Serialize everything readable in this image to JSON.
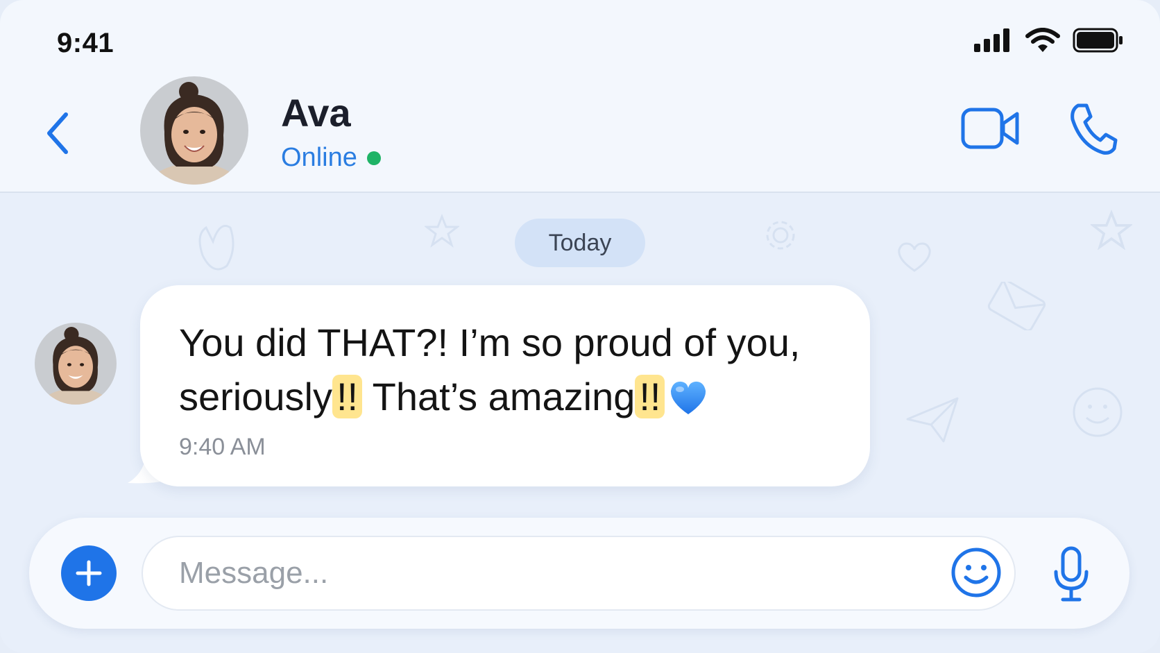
{
  "status_bar": {
    "time": "9:41",
    "icons": [
      "cellular-signal-icon",
      "wifi-icon",
      "battery-icon"
    ]
  },
  "header": {
    "back_icon": "chevron-left-icon",
    "contact_name": "Ava",
    "presence": "Online",
    "presence_color": "#1fb366",
    "actions": [
      "video-call-icon",
      "phone-icon"
    ]
  },
  "chat": {
    "date_divider": "Today",
    "messages": [
      {
        "sender": "Ava",
        "text_part1": "You did THAT?! I’m so proud of you, seriously",
        "highlight1": "!!",
        "text_part2": " That’s amazing",
        "highlight2": "!!",
        "emoji": "blue-heart",
        "time": "9:40 AM"
      }
    ]
  },
  "composer": {
    "placeholder": "Message...",
    "value": "",
    "buttons": [
      "plus-icon",
      "smiley-icon",
      "microphone-icon"
    ]
  },
  "colors": {
    "accent": "#1f74e8",
    "presence_text": "#2a7de1",
    "highlight": "#ffe58f"
  }
}
